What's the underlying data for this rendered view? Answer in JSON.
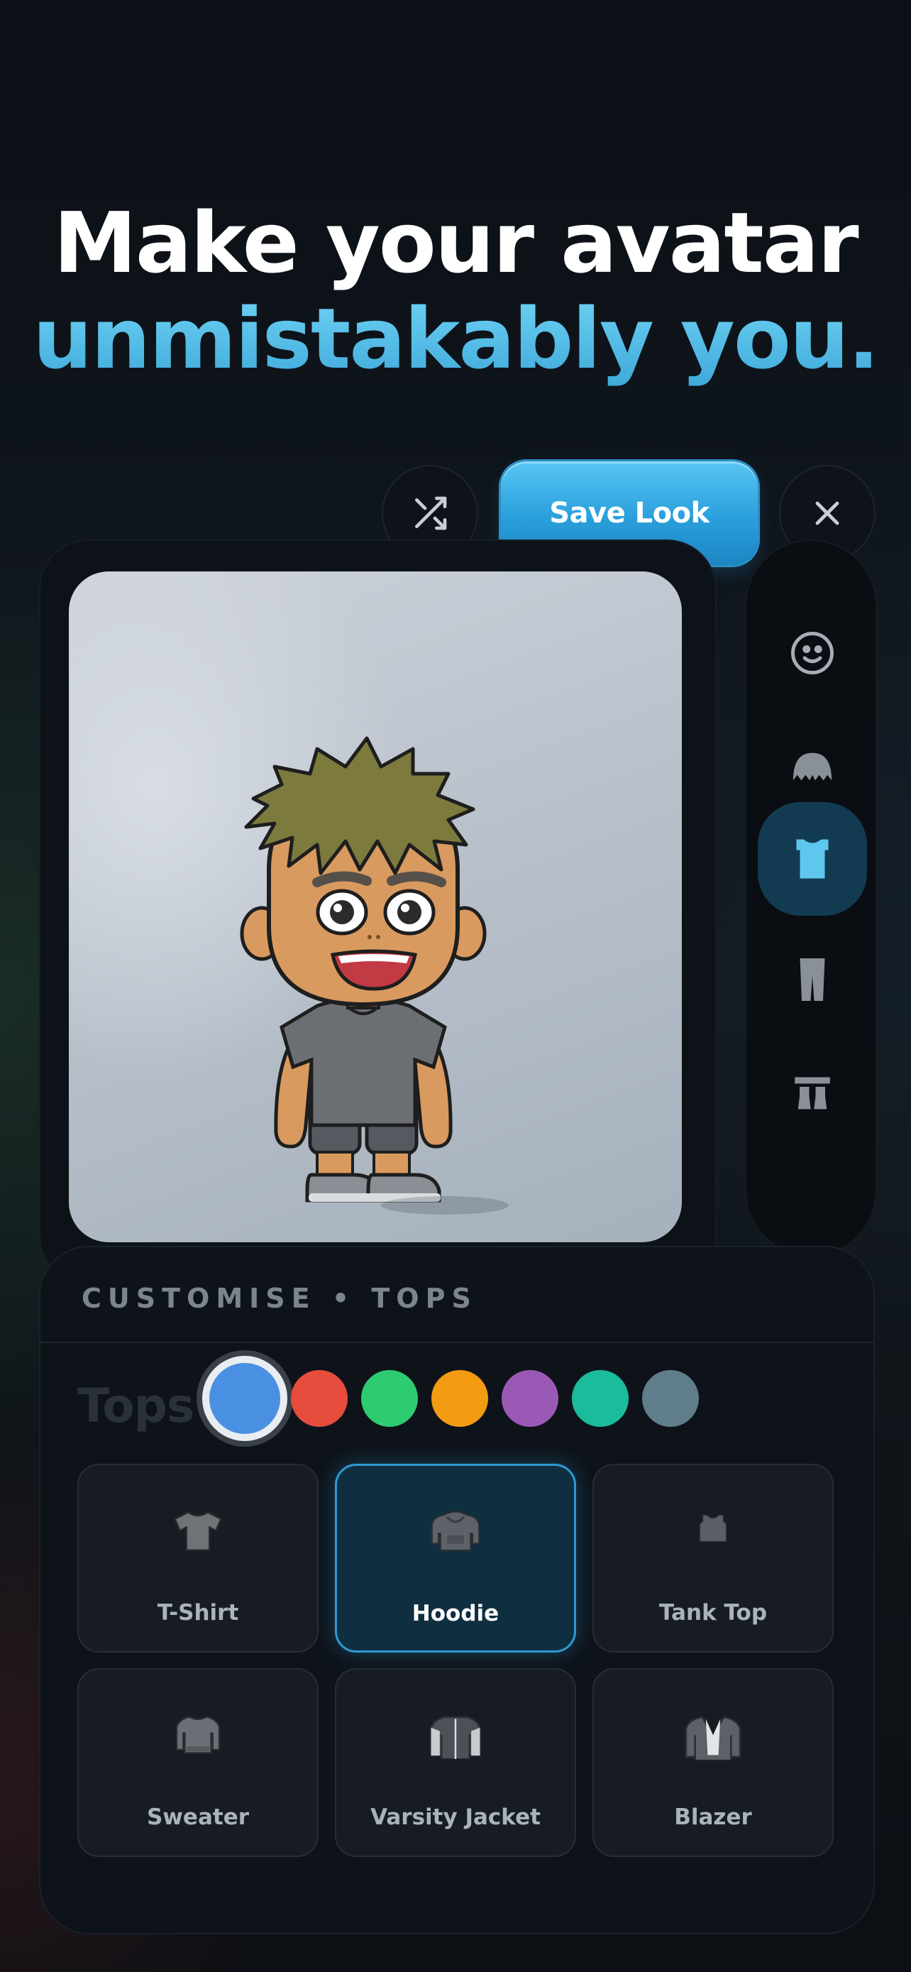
{
  "headline": {
    "line1": "Make your avatar",
    "line2": "unmistakably you."
  },
  "toolbar": {
    "save_label": "Save Look",
    "shuffle_icon": "shuffle-icon",
    "close_icon": "close-icon"
  },
  "rail": {
    "items": [
      {
        "name": "face",
        "icon": "smiley-face-icon",
        "active": false
      },
      {
        "name": "hair",
        "icon": "hair-icon",
        "active": false
      },
      {
        "name": "tops",
        "icon": "shirt-icon",
        "active": true
      },
      {
        "name": "bottoms",
        "icon": "pants-icon",
        "active": false
      },
      {
        "name": "shoes",
        "icon": "shoes-icon",
        "active": false
      }
    ]
  },
  "panel": {
    "title": "CUSTOMISE • TOPS",
    "section_label": "Tops",
    "colors": [
      "#4a90e2",
      "#e74c3c",
      "#2ecc71",
      "#f39c12",
      "#9b59b6",
      "#1abc9c",
      "#607d8b"
    ],
    "selected_color": "#4a90e2",
    "items": [
      {
        "label": "T-Shirt",
        "icon": "tshirt-icon",
        "selected": false
      },
      {
        "label": "Hoodie",
        "icon": "hoodie-icon",
        "selected": true
      },
      {
        "label": "Tank Top",
        "icon": "tank-top-icon",
        "selected": false
      },
      {
        "label": "Sweater",
        "icon": "sweater-icon",
        "selected": false
      },
      {
        "label": "Varsity Jacket",
        "icon": "varsity-jacket-icon",
        "selected": false
      },
      {
        "label": "Blazer",
        "icon": "blazer-icon",
        "selected": false
      }
    ]
  }
}
